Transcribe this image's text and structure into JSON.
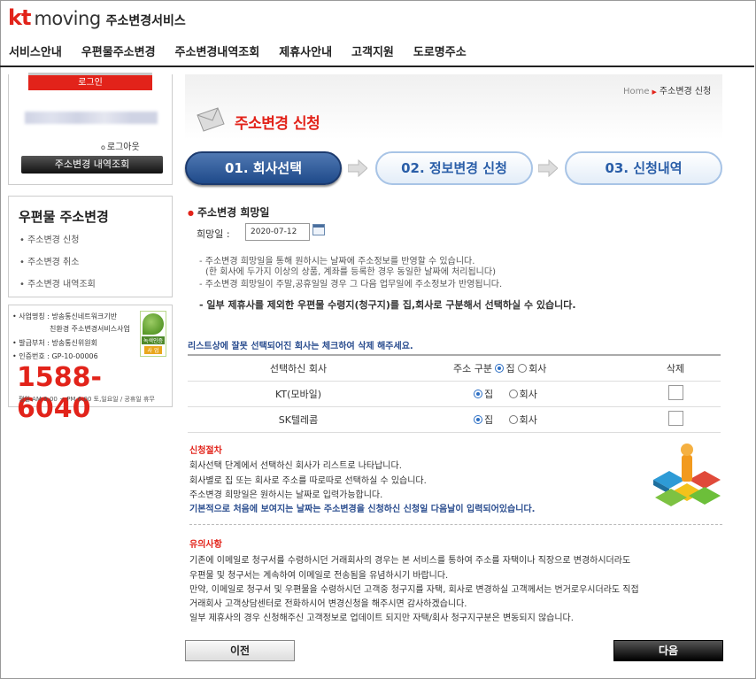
{
  "header": {
    "logo_kt": "kt",
    "logo_moving": "moving",
    "logo_service": "주소변경서비스",
    "nav": [
      "서비스안내",
      "우편물주소변경",
      "주소변경내역조회",
      "제휴사안내",
      "고객지원",
      "도로명주소"
    ]
  },
  "sidebar": {
    "login_tab": "로그인",
    "logout": "로그아웃",
    "history_button": "주소변경 내역조회",
    "menu_title": "우편물 주소변경",
    "menu_items": [
      "주소변경 신청",
      "주소변경 취소",
      "주소변경 내역조회"
    ],
    "info": {
      "operator_label": "• 사업명칭 : 방송통신네트워크기반",
      "operator_label2": "친환경 주소변경서비스사업",
      "issuer": "• 발급부처 : 방송통신위원회",
      "cert_no": "• 인증번호 : GP-10-00006",
      "cert_badge_1": "녹색인증",
      "cert_badge_2": "사 업",
      "phone": "1588-6040",
      "hours": "평일 AM 9:00 ~ PM 6:00 토,일요일 / 공휴일 휴무"
    }
  },
  "breadcrumb": {
    "home": "Home",
    "current": "주소변경 신청"
  },
  "page_title": "주소변경 신청",
  "steps": [
    "01. 회사선택",
    "02. 정보변경 신청",
    "03. 신청내역"
  ],
  "date_section": {
    "title": "주소변경 희망일",
    "label": "희망일 :",
    "value": "2020-07-12"
  },
  "notes": [
    "- 주소변경 희망일을 통해 원하시는 날짜에 주소정보를 반영할 수 있습니다.",
    "(한 회사에 두가지 이상의 상품, 계좌를 등록한 경우 동일한 날짜에 처리됩니다)",
    "- 주소변경 희망일이 주말,공휴일일 경우 그 다음 업무일에 주소정보가 반영됩니다."
  ],
  "note_bold": "- 일부 제휴사를 제외한 우편물 수령지(청구지)를 집,회사로 구분해서 선택하실 수 있습니다.",
  "list_note": "리스트상에 잘못 선택되어진 회사는 체크하여 삭제 해주세요.",
  "table": {
    "headers": {
      "company": "선택하신 회사",
      "addr_type": "주소 구분",
      "home": "집",
      "work": "회사",
      "delete": "삭제"
    },
    "rows": [
      {
        "company": "KT(모바일)",
        "home": "집",
        "work": "회사"
      },
      {
        "company": "SK텔레콤",
        "home": "집",
        "work": "회사"
      }
    ]
  },
  "procedure": {
    "title": "신청절차",
    "lines": [
      "회사선택 단계에서 선택하신 회사가 리스트로 나타납니다.",
      "회사별로 집 또는 회사로 주소를 따로따로 선택하실 수 있습니다.",
      "주소변경 희망일은 원하시는 날짜로 입력가능합니다."
    ],
    "highlight": "기본적으로 처음에 보여지는 날짜는 주소변경을 신청하신 신청일 다음날이 입력되어있습니다."
  },
  "caution": {
    "title": "유의사항",
    "lines": [
      "기존에 이메일로 청구서를 수령하시던 거래회사의 경우는 본 서비스를 통하여 주소를 자택이나 직장으로 변경하시더라도",
      "우편물 및 청구서는 계속하여 이메일로 전송됨을 유념하시기 바랍니다.",
      "만약, 이메일로 청구서 및 우편물을 수령하시던 고객중 청구지를 자택, 회사로 변경하실 고객께서는 번거로우시더라도 직접",
      "거래회사 고객상담센터로 전화하시어 변경신청을 해주시면 감사하겠습니다.",
      "일부 제휴사의 경우 신청해주신 고객정보로 업데이트 되지만 자택/회사 청구지구분은 변동되지 않습니다."
    ]
  },
  "buttons": {
    "prev": "이전",
    "next": "다음"
  },
  "colors": {
    "brand_red": "#e2231a",
    "step_blue": "#1f4a8a",
    "link_blue": "#2a4d8f"
  }
}
